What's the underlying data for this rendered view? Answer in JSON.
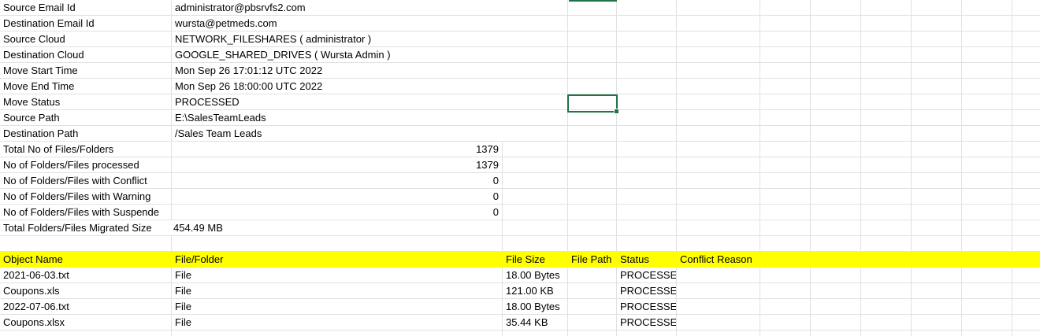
{
  "summary": [
    {
      "label": "Source Email Id",
      "value": "administrator@pbsrvfs2.com"
    },
    {
      "label": "Destination Email Id",
      "value": "wursta@petmeds.com"
    },
    {
      "label": "Source Cloud",
      "value": "NETWORK_FILESHARES ( administrator )"
    },
    {
      "label": "Destination Cloud",
      "value": "GOOGLE_SHARED_DRIVES ( Wursta Admin )"
    },
    {
      "label": "Move Start Time",
      "value": "Mon Sep 26 17:01:12 UTC 2022"
    },
    {
      "label": "Move End Time",
      "value": "Mon Sep 26 18:00:00 UTC 2022"
    },
    {
      "label": "Move Status",
      "value": "PROCESSED"
    },
    {
      "label": "Source Path",
      "value": "E:\\SalesTeamLeads"
    },
    {
      "label": "Destination Path",
      "value": "/Sales Team Leads"
    }
  ],
  "counts": [
    {
      "label": "Total No of Files/Folders",
      "value": "1379"
    },
    {
      "label": "No of Folders/Files processed",
      "value": "1379"
    },
    {
      "label": "No of Folders/Files with Conflict",
      "value": "0"
    },
    {
      "label": "No of Folders/Files with Warning",
      "value": "0"
    },
    {
      "label": "No of Folders/Files with Suspende",
      "value": "0"
    }
  ],
  "total_size": {
    "label": "Total Folders/Files Migrated Size",
    "value": "454.49 MB"
  },
  "table": {
    "headers": [
      "Object Name",
      "File/Folder",
      "File Size",
      "File Path",
      "Status",
      "Conflict Reason"
    ],
    "rows": [
      [
        "2021-06-03.txt",
        "File",
        "18.00 Bytes",
        "",
        "PROCESSED",
        ""
      ],
      [
        "Coupons.xls",
        "File",
        "121.00 KB",
        "",
        "PROCESSED",
        ""
      ],
      [
        "2022-07-06.txt",
        "File",
        "18.00 Bytes",
        "",
        "PROCESSED",
        ""
      ],
      [
        "Coupons.xlsx",
        "File",
        "35.44 KB",
        "",
        "PROCESSED",
        ""
      ]
    ]
  },
  "colors": {
    "highlight": "#ffff00",
    "selection": "#217346",
    "gridline": "#e1e1e1"
  }
}
